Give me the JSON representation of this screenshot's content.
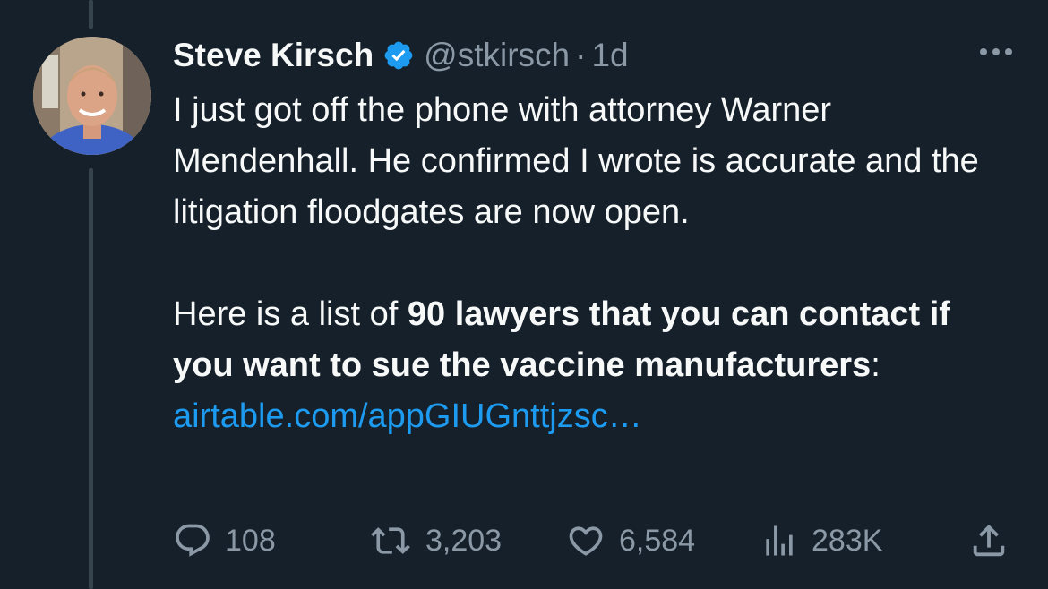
{
  "user": {
    "display_name": "Steve Kirsch",
    "handle": "@stkirsch",
    "separator": "·",
    "time": "1d"
  },
  "tweet": {
    "line1": "I just got off the phone with attorney Warner Mendenhall. He confirmed I wrote is accurate and the litigation floodgates are now open.",
    "line2_prefix": "Here is a list of ",
    "line2_bold": "90 lawyers that you can contact if you want to sue the vaccine manufacturers",
    "line2_colon": ": ",
    "link_text": "airtable.com/​appGIUGnttjzsc…"
  },
  "actions": {
    "replies": "108",
    "retweets": "3,203",
    "likes": "6,584",
    "views": "283K"
  },
  "colors": {
    "background": "#15202b",
    "text": "#f7f9f9",
    "muted": "#8b98a5",
    "link": "#1d9bf0",
    "thread": "#38444d"
  },
  "icons": [
    "verified-badge-icon",
    "more-icon",
    "reply-icon",
    "retweet-icon",
    "like-icon",
    "views-icon",
    "share-icon"
  ]
}
